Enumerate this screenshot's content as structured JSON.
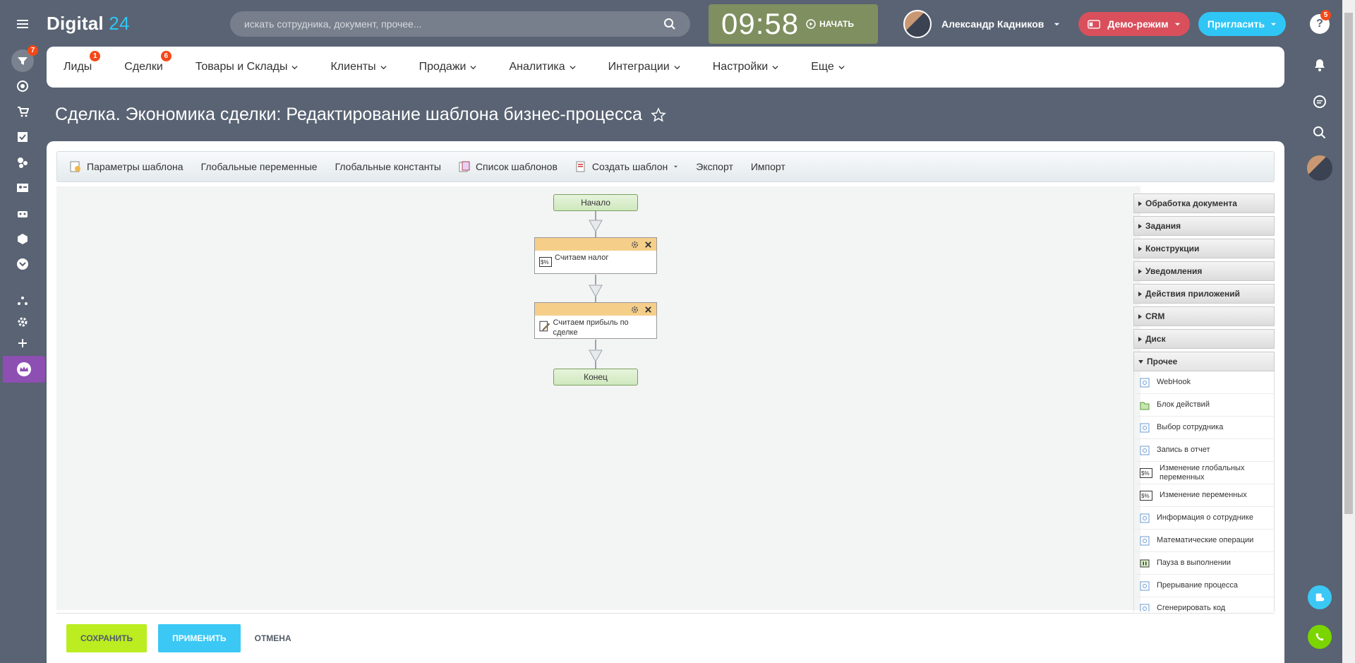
{
  "header": {
    "logo_text": "Digital",
    "logo_num": "24",
    "search_placeholder": "искать сотрудника, документ, прочее...",
    "clock_time": "09:58",
    "clock_start": "НАЧАТЬ",
    "user_name": "Александр Кадников",
    "demo_label": "Демо-режим",
    "invite_label": "Пригласить",
    "help_badge": "5"
  },
  "left_bar": {
    "filter_badge": "7"
  },
  "menu": {
    "items": [
      {
        "label": "Лиды",
        "badge": "1"
      },
      {
        "label": "Сделки",
        "badge": "6"
      },
      {
        "label": "Товары и Склады"
      },
      {
        "label": "Клиенты"
      },
      {
        "label": "Продажи"
      },
      {
        "label": "Аналитика"
      },
      {
        "label": "Интеграции"
      },
      {
        "label": "Настройки"
      },
      {
        "label": "Еще"
      }
    ]
  },
  "page": {
    "title": "Сделка. Экономика сделки: Редактирование шаблона бизнес-процесса"
  },
  "toolbar": {
    "items": [
      "Параметры шаблона",
      "Глобальные переменные",
      "Глобальные константы",
      "Список шаблонов",
      "Создать шаблон",
      "Экспорт",
      "Импорт"
    ]
  },
  "flow": {
    "start": "Начало",
    "activities": [
      "Считаем налог",
      "Считаем прибыль по сделке"
    ],
    "end": "Конец"
  },
  "panel": {
    "categories": [
      "Обработка документа",
      "Задания",
      "Конструкции",
      "Уведомления",
      "Действия приложений",
      "CRM",
      "Диск",
      "Прочее"
    ],
    "items": [
      "WebHook",
      "Блок действий",
      "Выбор сотрудника",
      "Запись в отчет",
      "Изменение глобальных переменных",
      "Изменение переменных",
      "Информация о сотруднике",
      "Математические операции",
      "Пауза в выполнении",
      "Прерывание процесса",
      "Сгенерировать код"
    ]
  },
  "footer": {
    "save": "СОХРАНИТЬ",
    "apply": "ПРИМЕНИТЬ",
    "cancel": "ОТМЕНА"
  },
  "colors": {
    "accent": "#2fc6f6",
    "badge": "#f54819",
    "save": "#bbed21"
  }
}
